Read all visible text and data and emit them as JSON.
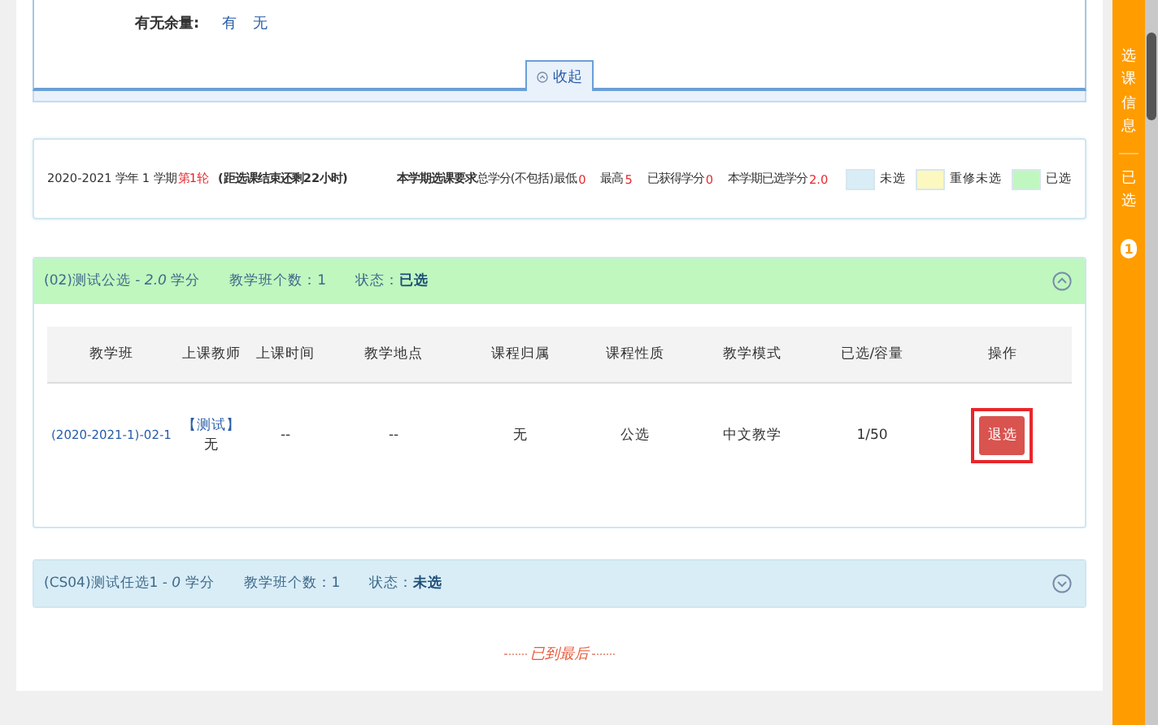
{
  "filter": {
    "label": "有无余量:",
    "options": [
      {
        "text": "有"
      },
      {
        "text": "无"
      }
    ],
    "collapse": "收起"
  },
  "summary": {
    "segments": [
      {
        "text": "2020-2021 学年 1 学期",
        "kind": "plain"
      },
      {
        "text": "第1轮",
        "kind": "red"
      },
      {
        "text": "(距选课结束还剩22小时)",
        "kind": "bold"
      },
      {
        "text": "本学期选课要求",
        "kind": "bold"
      },
      {
        "text": "总学分(不包括)最低",
        "kind": "plain"
      },
      {
        "text": "0",
        "kind": "red"
      },
      {
        "text": "最高",
        "kind": "plain"
      },
      {
        "text": "5",
        "kind": "red"
      },
      {
        "text": "已获得学分",
        "kind": "plain"
      },
      {
        "text": "0",
        "kind": "red"
      },
      {
        "text": "本学期已选学分",
        "kind": "plain"
      },
      {
        "text": "2.0",
        "kind": "red"
      }
    ],
    "legend": [
      {
        "label": "未选",
        "color": "#d9edf7"
      },
      {
        "label": "重修未选",
        "color": "#fcf8c0"
      },
      {
        "label": "已选",
        "color": "#bff7bf"
      }
    ]
  },
  "courses": [
    {
      "title": "(02)测试公选 - *2.0* 学分",
      "count": "教学班个数：1",
      "status_label": "状态：",
      "status": "已选",
      "selected": true,
      "expanded": true,
      "columns": [
        "教学班",
        "上课教师",
        "上课时间",
        "教学地点",
        "课程归属",
        "课程性质",
        "教学模式",
        "已选/容量",
        "操作"
      ],
      "rows": [
        {
          "cells": [
            {
              "kind": "link",
              "text": "(2020-2021-1)-02-1"
            },
            {
              "kind": "teacher",
              "tag": "【测试】",
              "text": "无"
            },
            {
              "kind": "text",
              "text": "--"
            },
            {
              "kind": "text",
              "text": "--"
            },
            {
              "kind": "text",
              "text": "无"
            },
            {
              "kind": "text",
              "text": "公选"
            },
            {
              "kind": "text",
              "text": "中文教学"
            },
            {
              "kind": "text",
              "text": "1/50"
            },
            {
              "kind": "action",
              "text": "退选",
              "highlighted": true
            }
          ]
        }
      ]
    },
    {
      "title": "(CS04)测试任选1 - *0* 学分",
      "count": "教学班个数：1",
      "status_label": "状态：",
      "status": "未选",
      "selected": false,
      "expanded": false
    }
  ],
  "end_text": "已到最后",
  "sidebar": {
    "title": "选课信息",
    "selected_label": "已选",
    "badge": "1"
  }
}
